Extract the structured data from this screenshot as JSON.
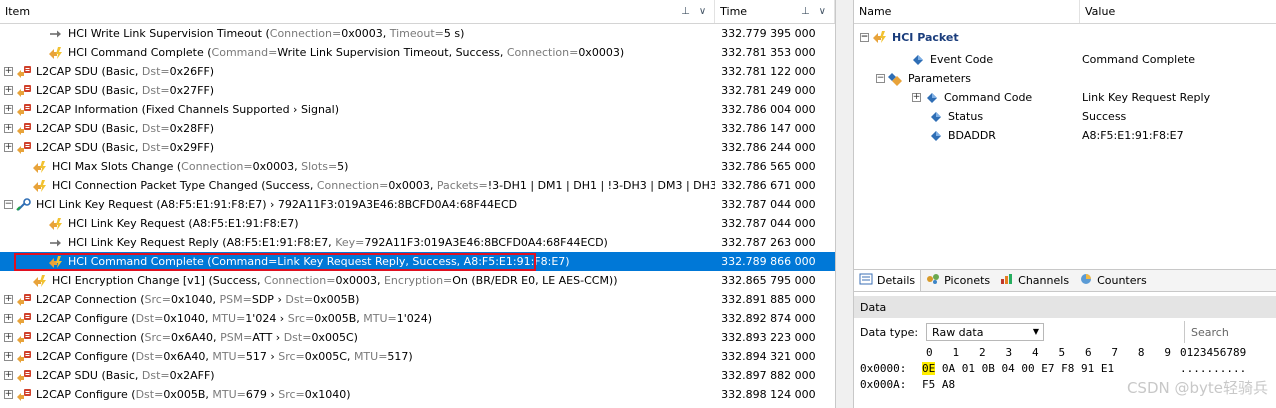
{
  "left_header": {
    "item": "Item",
    "time": "Time"
  },
  "rows": [
    {
      "exp": "",
      "icon": "arrow",
      "indent": 2,
      "parts": [
        [
          "HCI Write Link Supervision Timeout (",
          ""
        ],
        [
          "Connection=",
          "g"
        ],
        [
          "0x0003, ",
          ""
        ],
        [
          "Timeout=",
          "g"
        ],
        [
          "5 s)",
          ""
        ]
      ],
      "time": "332.779 395 000"
    },
    {
      "exp": "",
      "icon": "event",
      "indent": 2,
      "parts": [
        [
          "HCI Command Complete (",
          ""
        ],
        [
          "Command=",
          "g"
        ],
        [
          "Write Link Supervision Timeout, Success, ",
          ""
        ],
        [
          "Connection=",
          "g"
        ],
        [
          "0x0003)",
          ""
        ]
      ],
      "time": "332.781 353 000"
    },
    {
      "exp": "+",
      "icon": "l2cap",
      "indent": 0,
      "parts": [
        [
          "L2CAP SDU (Basic, ",
          ""
        ],
        [
          "Dst=",
          "g"
        ],
        [
          "0x26FF)",
          ""
        ]
      ],
      "time": "332.781 122 000"
    },
    {
      "exp": "+",
      "icon": "l2cap",
      "indent": 0,
      "parts": [
        [
          "L2CAP SDU (Basic, ",
          ""
        ],
        [
          "Dst=",
          "g"
        ],
        [
          "0x27FF)",
          ""
        ]
      ],
      "time": "332.781 249 000"
    },
    {
      "exp": "+",
      "icon": "l2cap",
      "indent": 0,
      "parts": [
        [
          "L2CAP Information (Fixed Channels Supported › Signal)",
          ""
        ]
      ],
      "time": "332.786 004 000"
    },
    {
      "exp": "+",
      "icon": "l2cap",
      "indent": 0,
      "parts": [
        [
          "L2CAP SDU (Basic, ",
          ""
        ],
        [
          "Dst=",
          "g"
        ],
        [
          "0x28FF)",
          ""
        ]
      ],
      "time": "332.786 147 000"
    },
    {
      "exp": "+",
      "icon": "l2cap",
      "indent": 0,
      "parts": [
        [
          "L2CAP SDU (Basic, ",
          ""
        ],
        [
          "Dst=",
          "g"
        ],
        [
          "0x29FF)",
          ""
        ]
      ],
      "time": "332.786 244 000"
    },
    {
      "exp": "",
      "icon": "event",
      "indent": 1,
      "parts": [
        [
          "HCI Max Slots Change (",
          ""
        ],
        [
          "Connection=",
          "g"
        ],
        [
          "0x0003, ",
          ""
        ],
        [
          "Slots=",
          "g"
        ],
        [
          "5)",
          ""
        ]
      ],
      "time": "332.786 565 000"
    },
    {
      "exp": "",
      "icon": "event",
      "indent": 1,
      "parts": [
        [
          "HCI Connection Packet Type Changed (Success, ",
          ""
        ],
        [
          "Connection=",
          "g"
        ],
        [
          "0x0003, ",
          ""
        ],
        [
          "Packets=",
          "g"
        ],
        [
          "!3-DH1 | DM1 | DH1 | !3-DH3 | DM3 | DH3 | !3-DH5 | DM5...",
          ""
        ]
      ],
      "time": "332.786 671 000"
    },
    {
      "exp": "−",
      "icon": "linkkey",
      "indent": 0,
      "parts": [
        [
          "HCI Link Key Request (A8:F5:E1:91:F8:E7) › 792A11F3:019A3E46:8BCFD0A4:68F44ECD",
          ""
        ]
      ],
      "time": "332.787 044 000"
    },
    {
      "exp": "",
      "icon": "event",
      "indent": 2,
      "parts": [
        [
          "HCI Link Key Request (A8:F5:E1:91:F8:E7)",
          ""
        ]
      ],
      "time": "332.787 044 000"
    },
    {
      "exp": "",
      "icon": "arrow",
      "indent": 2,
      "parts": [
        [
          "HCI Link Key Request Reply (A8:F5:E1:91:F8:E7, ",
          ""
        ],
        [
          "Key=",
          "g"
        ],
        [
          "792A11F3:019A3E46:8BCFD0A4:68F44ECD)",
          ""
        ]
      ],
      "time": "332.787 263 000"
    },
    {
      "exp": "",
      "icon": "event",
      "indent": 2,
      "sel": true,
      "parts": [
        [
          "HCI Command Complete (",
          ""
        ],
        [
          "Command=",
          "g"
        ],
        [
          "Link Key Request Reply, Success, A8:F5:E1:91:F8:E7)",
          ""
        ]
      ],
      "time": "332.789 866 000"
    },
    {
      "exp": "",
      "icon": "event",
      "indent": 1,
      "parts": [
        [
          "HCI Encryption Change [v1] (Success, ",
          ""
        ],
        [
          "Connection=",
          "g"
        ],
        [
          "0x0003, ",
          ""
        ],
        [
          "Encryption=",
          "g"
        ],
        [
          "On (BR/EDR E0, LE AES-CCM))",
          ""
        ]
      ],
      "time": "332.865 795 000"
    },
    {
      "exp": "+",
      "icon": "l2cap",
      "indent": 0,
      "parts": [
        [
          "L2CAP Connection (",
          ""
        ],
        [
          "Src=",
          "g"
        ],
        [
          "0x1040, ",
          ""
        ],
        [
          "PSM=",
          "g"
        ],
        [
          "SDP › ",
          ""
        ],
        [
          "Dst=",
          "g"
        ],
        [
          "0x005B)",
          ""
        ]
      ],
      "time": "332.891 885 000"
    },
    {
      "exp": "+",
      "icon": "l2cap",
      "indent": 0,
      "parts": [
        [
          "L2CAP Configure (",
          ""
        ],
        [
          "Dst=",
          "g"
        ],
        [
          "0x1040, ",
          ""
        ],
        [
          "MTU=",
          "g"
        ],
        [
          "1'024 › ",
          ""
        ],
        [
          "Src=",
          "g"
        ],
        [
          "0x005B, ",
          ""
        ],
        [
          "MTU=",
          "g"
        ],
        [
          "1'024)",
          ""
        ]
      ],
      "time": "332.892 874 000"
    },
    {
      "exp": "+",
      "icon": "l2cap",
      "indent": 0,
      "parts": [
        [
          "L2CAP Connection (",
          ""
        ],
        [
          "Src=",
          "g"
        ],
        [
          "0x6A40, ",
          ""
        ],
        [
          "PSM=",
          "g"
        ],
        [
          "ATT › ",
          ""
        ],
        [
          "Dst=",
          "g"
        ],
        [
          "0x005C)",
          ""
        ]
      ],
      "time": "332.893 223 000"
    },
    {
      "exp": "+",
      "icon": "l2cap",
      "indent": 0,
      "parts": [
        [
          "L2CAP Configure (",
          ""
        ],
        [
          "Dst=",
          "g"
        ],
        [
          "0x6A40, ",
          ""
        ],
        [
          "MTU=",
          "g"
        ],
        [
          "517 › ",
          ""
        ],
        [
          "Src=",
          "g"
        ],
        [
          "0x005C, ",
          ""
        ],
        [
          "MTU=",
          "g"
        ],
        [
          "517)",
          ""
        ]
      ],
      "time": "332.894 321 000"
    },
    {
      "exp": "+",
      "icon": "l2cap",
      "indent": 0,
      "parts": [
        [
          "L2CAP SDU (Basic, ",
          ""
        ],
        [
          "Dst=",
          "g"
        ],
        [
          "0x2AFF)",
          ""
        ]
      ],
      "time": "332.897 882 000"
    },
    {
      "exp": "+",
      "icon": "l2cap",
      "indent": 0,
      "parts": [
        [
          "L2CAP Configure (",
          ""
        ],
        [
          "Dst=",
          "g"
        ],
        [
          "0x005B, ",
          ""
        ],
        [
          "MTU=",
          "g"
        ],
        [
          "679 › ",
          ""
        ],
        [
          "Src=",
          "g"
        ],
        [
          "0x1040)",
          ""
        ]
      ],
      "time": "332.898 124 000"
    }
  ],
  "right_header": {
    "name": "Name",
    "value": "Value"
  },
  "packet": {
    "title": "HCI Packet",
    "fields": [
      {
        "exp": "",
        "icon": "diamond",
        "indent": 1,
        "name": "Event Code",
        "value": "Command Complete"
      },
      {
        "exp": "−",
        "icon": "params",
        "indent": 0,
        "name": "Parameters",
        "value": ""
      },
      {
        "exp": "+",
        "icon": "diamond",
        "indent": 2,
        "name": "Command Code",
        "value": "Link Key Request Reply"
      },
      {
        "exp": "",
        "icon": "diamond",
        "indent": 2,
        "name": "Status",
        "value": "Success"
      },
      {
        "exp": "",
        "icon": "diamond",
        "indent": 2,
        "name": "BDADDR",
        "value": "A8:F5:E1:91:F8:E7"
      }
    ]
  },
  "tabs": [
    "Details",
    "Piconets",
    "Channels",
    "Counters"
  ],
  "data_panel": {
    "title": "Data",
    "type_label": "Data type:",
    "type_value": "Raw data",
    "search_placeholder": "Search",
    "col_header": "0   1   2   3   4   5   6   7   8   9",
    "ascii_header": "0123456789",
    "lines": [
      {
        "offset": "0x0000:",
        "bytes": [
          "0E",
          "0A",
          "01",
          "0B",
          "04",
          "00",
          "E7",
          "F8",
          "91",
          "E1"
        ],
        "ascii": ".........."
      },
      {
        "offset": "0x000A:",
        "bytes": [
          "F5",
          "A8"
        ],
        "ascii": ""
      }
    ]
  },
  "watermark": "CSDN @byte轻骑兵",
  "colors": {
    "selection": "#0078d7",
    "highlight_border": "#e01020",
    "hex_highlight": "#ffee00"
  }
}
